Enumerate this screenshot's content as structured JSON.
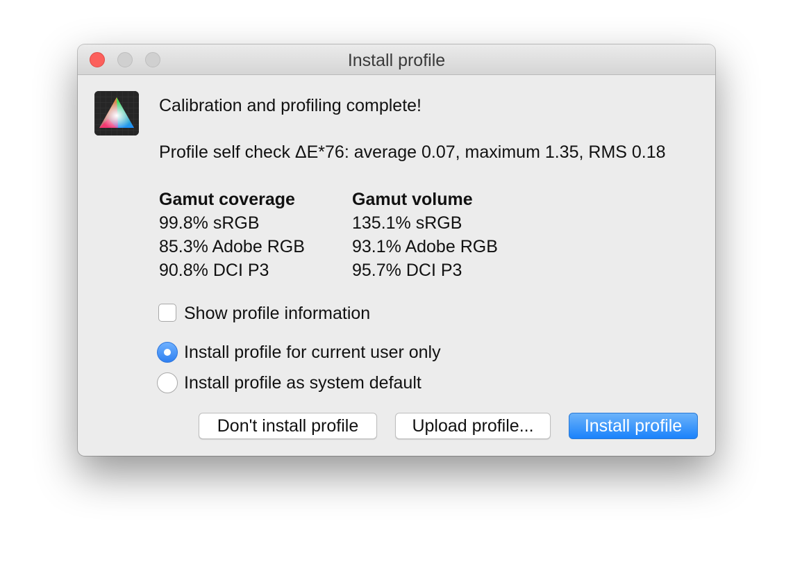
{
  "window": {
    "title": "Install profile"
  },
  "icons": {
    "app": "color-triangle-icon",
    "traffic_lights": [
      "close-icon",
      "minimize-icon",
      "zoom-icon"
    ]
  },
  "content": {
    "headline": "Calibration and profiling complete!",
    "self_check": "Profile self check ΔE*76: average 0.07, maximum 1.35, RMS 0.18",
    "gamut_coverage": {
      "heading": "Gamut coverage",
      "rows": [
        "99.8% sRGB",
        "85.3% Adobe RGB",
        "90.8% DCI P3"
      ]
    },
    "gamut_volume": {
      "heading": "Gamut volume",
      "rows": [
        "135.1% sRGB",
        "93.1% Adobe RGB",
        "95.7% DCI P3"
      ]
    },
    "show_profile_info": {
      "label": "Show profile information",
      "checked": false
    },
    "install_scope": {
      "options": [
        {
          "label": "Install profile for current user only",
          "selected": true
        },
        {
          "label": "Install profile as system default",
          "selected": false
        }
      ]
    }
  },
  "buttons": {
    "dont_install": "Don't install profile",
    "upload": "Upload profile...",
    "install": "Install profile"
  },
  "colors": {
    "accent": "#1a82fb",
    "close": "#fc605c",
    "window_bg": "#ececec"
  }
}
